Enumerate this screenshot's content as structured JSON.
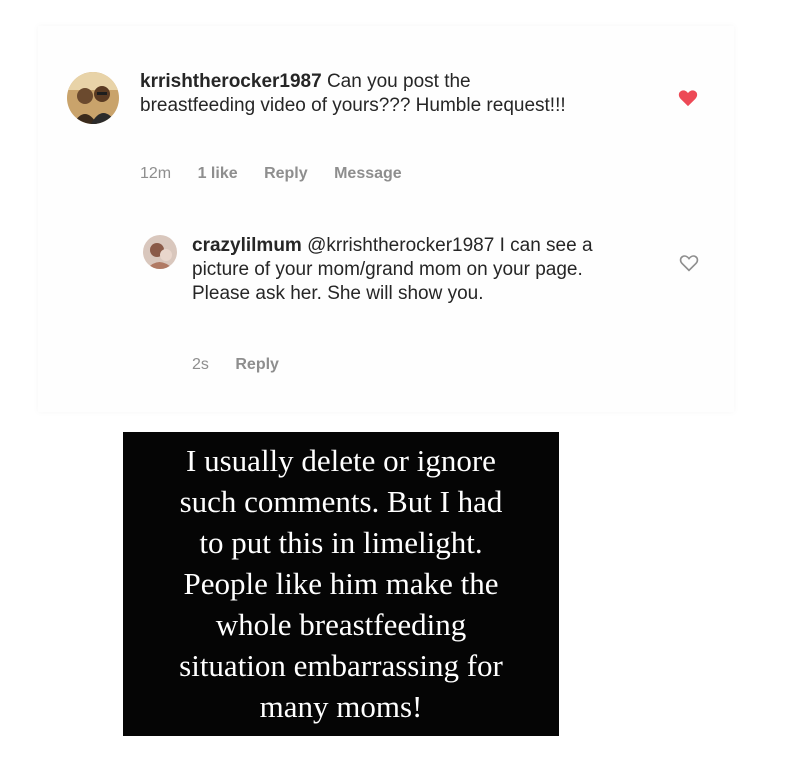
{
  "comments": [
    {
      "username": "krrishtherocker1987",
      "text": "Can you post the breastfeeding video of yours??? Humble request!!!",
      "time": "12m",
      "likes": "1 like",
      "reply_label": "Reply",
      "message_label": "Message",
      "liked": true,
      "heart_icon": "heart-filled-icon",
      "heart_color": "#ed4956"
    },
    {
      "username": "crazylilmum",
      "text": "@krrishtherocker1987 I can see a picture of your mom/grand mom on your page. Please ask her. She will show you.",
      "time": "2s",
      "reply_label": "Reply",
      "liked": false,
      "heart_icon": "heart-outline-icon"
    }
  ],
  "caption": {
    "text": "I usually delete or ignore\nsuch comments. But I had\nto put this in limelight.\nPeople like him make the\nwhole breastfeeding\nsituation embarrassing for\nmany moms!",
    "background": "#050505",
    "color": "#ffffff"
  }
}
